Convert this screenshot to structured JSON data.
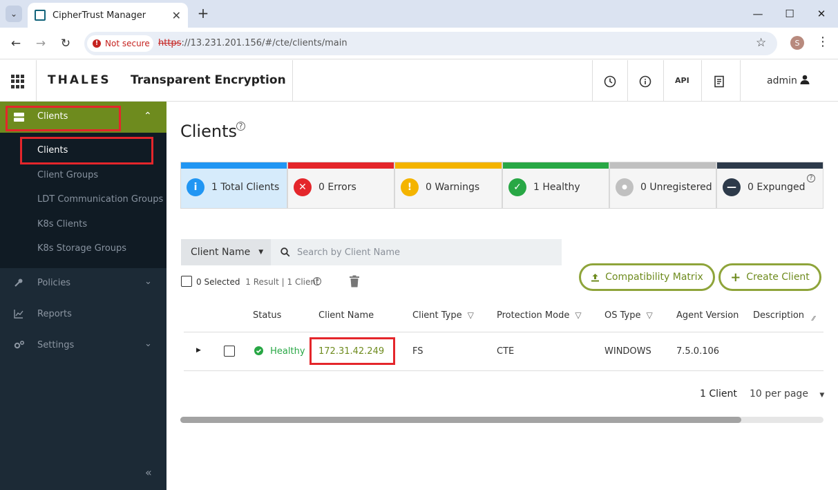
{
  "browser": {
    "tab_title": "CipherTrust Manager",
    "not_secure": "Not secure",
    "url_scheme": "https",
    "url_rest": "://13.231.201.156/#/cte/clients/main",
    "profile_initial": "S"
  },
  "header": {
    "brand": "THALES",
    "product": "Transparent Encryption",
    "api_label": "API",
    "user": "admin"
  },
  "sidebar": {
    "active_group": "Clients",
    "sub_items": [
      "Clients",
      "Client Groups",
      "LDT Communication Groups",
      "K8s Clients",
      "K8s Storage Groups"
    ],
    "nav": [
      {
        "label": "Policies",
        "icon": "wrench-icon"
      },
      {
        "label": "Reports",
        "icon": "chart-icon"
      },
      {
        "label": "Settings",
        "icon": "gears-icon"
      }
    ],
    "collapse_label": "«"
  },
  "main": {
    "title": "Clients",
    "stats": [
      {
        "label": "1 Total Clients",
        "color": "#2196f3",
        "icon": "i"
      },
      {
        "label": "0 Errors",
        "color": "#e4262b",
        "icon": "✕"
      },
      {
        "label": "0 Warnings",
        "color": "#f4b400",
        "icon": "!"
      },
      {
        "label": "1 Healthy",
        "color": "#28a745",
        "icon": "✓"
      },
      {
        "label": "0 Unregistered",
        "color": "#c0c0c0",
        "icon": "●"
      },
      {
        "label": "0 Expunged",
        "color": "#2d3a4a",
        "icon": "—"
      }
    ],
    "filter_select": "Client Name",
    "search_placeholder": "Search by Client Name",
    "compat_button": "Compatibility Matrix",
    "create_button": "Create Client",
    "selected_text": "0 Selected",
    "result_text": "1 Result | 1 Client",
    "columns": [
      "Status",
      "Client Name",
      "Client Type",
      "Protection Mode",
      "OS Type",
      "Agent Version",
      "Description"
    ],
    "rows": [
      {
        "status": "Healthy",
        "client_name": "172.31.42.249",
        "client_type": "FS",
        "protection_mode": "CTE",
        "os_type": "WINDOWS",
        "agent_version": "7.5.0.106",
        "description": ""
      }
    ],
    "pagination": {
      "total": "1 Client",
      "per_page": "10 per page"
    }
  },
  "colors": {
    "accent": "#6e8b1e",
    "highlight": "#e4262b",
    "healthy": "#28a745"
  }
}
